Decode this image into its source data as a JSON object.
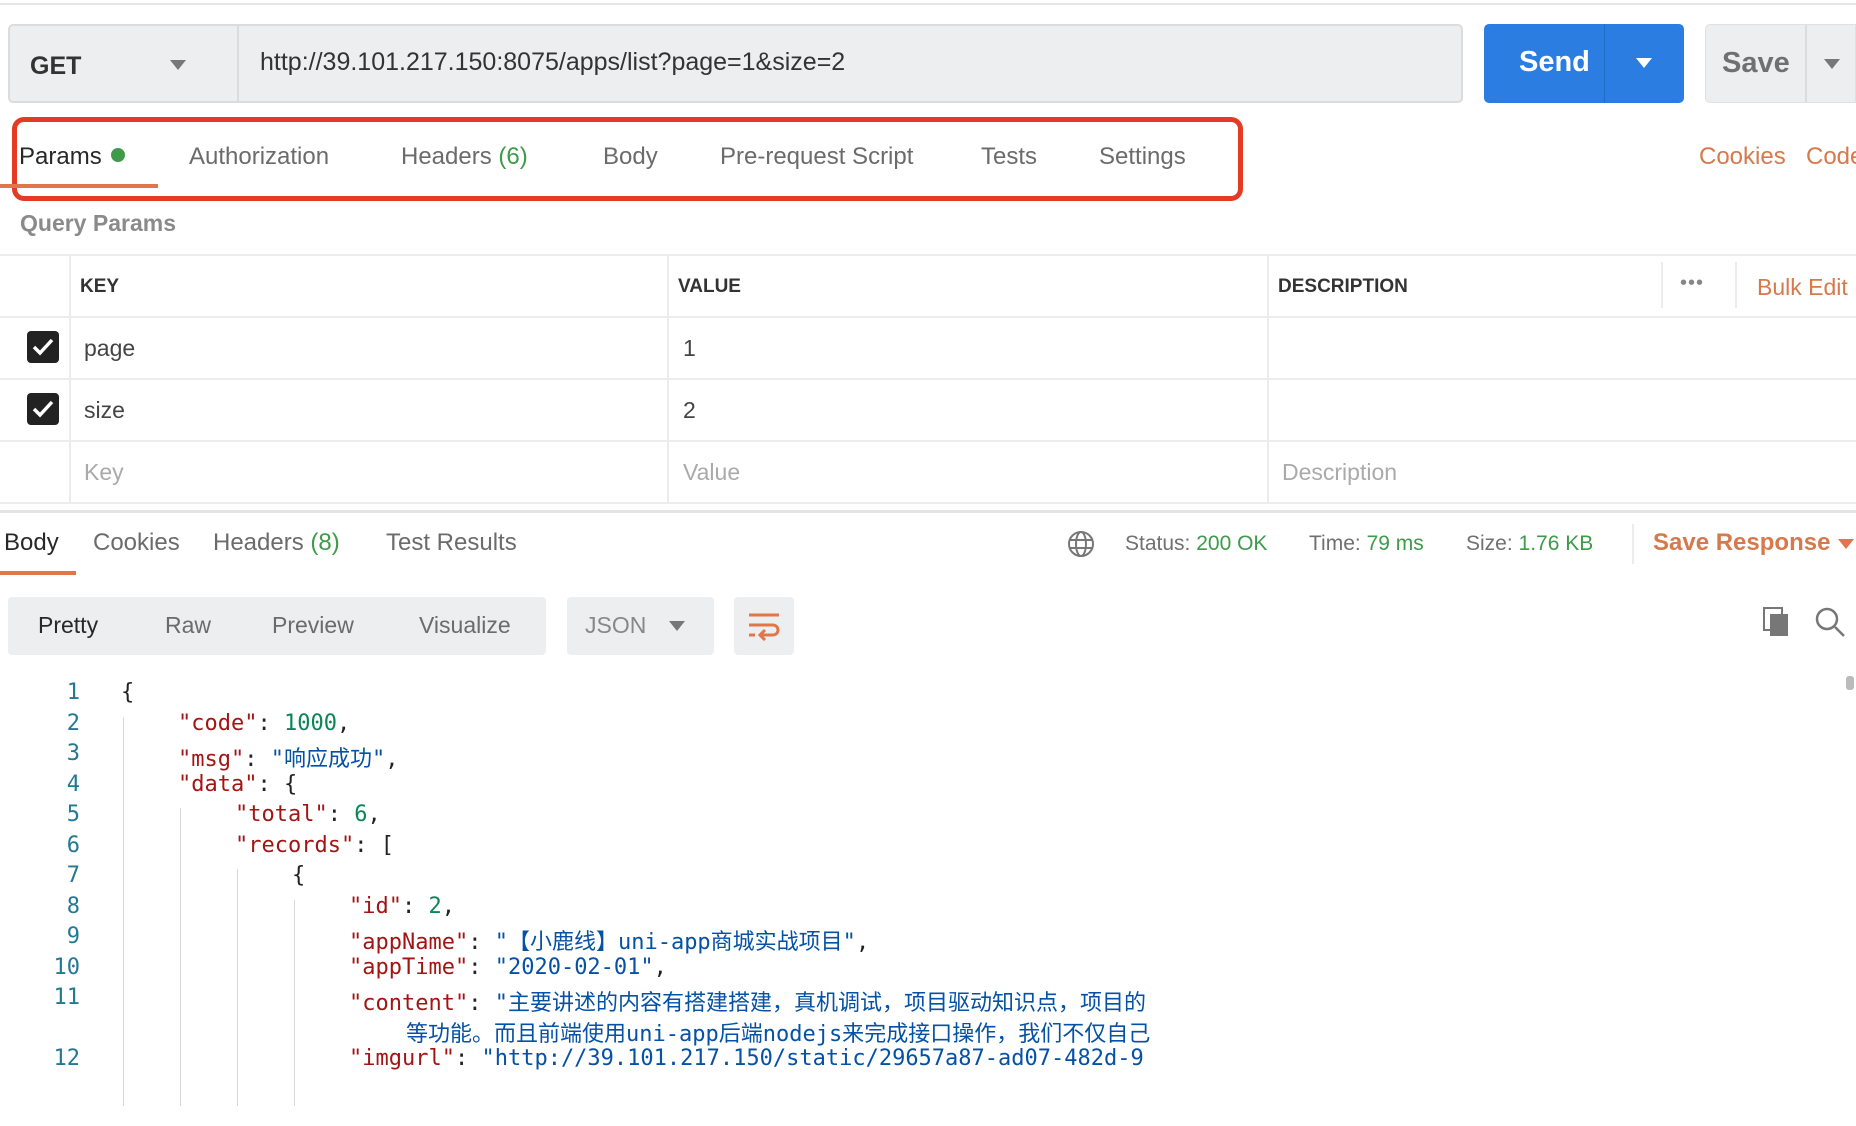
{
  "request": {
    "method": "GET",
    "url": "http://39.101.217.150:8075/apps/list?page=1&size=2",
    "send_label": "Send",
    "save_label": "Save"
  },
  "req_tabs": [
    {
      "label": "Params",
      "active": true
    },
    {
      "label": "Authorization"
    },
    {
      "label": "Headers",
      "count": "(6)"
    },
    {
      "label": "Body"
    },
    {
      "label": "Pre-request Script"
    },
    {
      "label": "Tests"
    },
    {
      "label": "Settings"
    }
  ],
  "req_links": {
    "cookies": "Cookies",
    "code": "Code"
  },
  "query_params": {
    "title": "Query Params",
    "columns": [
      "KEY",
      "VALUE",
      "DESCRIPTION"
    ],
    "more": "•••",
    "bulk_edit": "Bulk Edit",
    "rows": [
      {
        "checked": true,
        "key": "page",
        "value": "1",
        "description": ""
      },
      {
        "checked": true,
        "key": "size",
        "value": "2",
        "description": ""
      }
    ],
    "placeholder": {
      "key": "Key",
      "value": "Value",
      "description": "Description"
    }
  },
  "resp_tabs": [
    {
      "label": "Body",
      "active": true
    },
    {
      "label": "Cookies"
    },
    {
      "label": "Headers",
      "count": "(8)"
    },
    {
      "label": "Test Results"
    }
  ],
  "response_meta": {
    "status_label": "Status:",
    "status": "200 OK",
    "time_label": "Time:",
    "time": "79 ms",
    "size_label": "Size:",
    "size": "1.76 KB",
    "save_response": "Save Response"
  },
  "view_modes": [
    "Pretty",
    "Raw",
    "Preview",
    "Visualize"
  ],
  "active_view": "Pretty",
  "format": "JSON",
  "colors": {
    "accent": "#e0764a",
    "send": "#2b7de1",
    "success": "#3d9b4a",
    "highlight_box": "#e43b24"
  },
  "code_lines": [
    {
      "n": "1",
      "indent": 0,
      "parts": [
        [
          "p",
          "{"
        ]
      ]
    },
    {
      "n": "2",
      "indent": 1,
      "parts": [
        [
          "k",
          "\"code\""
        ],
        [
          "p",
          ": "
        ],
        [
          "n",
          "1000"
        ],
        [
          "p",
          ","
        ]
      ]
    },
    {
      "n": "3",
      "indent": 1,
      "parts": [
        [
          "k",
          "\"msg\""
        ],
        [
          "p",
          ": "
        ],
        [
          "s",
          "\"响应成功\""
        ],
        [
          "p",
          ","
        ]
      ]
    },
    {
      "n": "4",
      "indent": 1,
      "parts": [
        [
          "k",
          "\"data\""
        ],
        [
          "p",
          ": {"
        ]
      ]
    },
    {
      "n": "5",
      "indent": 2,
      "parts": [
        [
          "k",
          "\"total\""
        ],
        [
          "p",
          ": "
        ],
        [
          "n",
          "6"
        ],
        [
          "p",
          ","
        ]
      ]
    },
    {
      "n": "6",
      "indent": 2,
      "parts": [
        [
          "k",
          "\"records\""
        ],
        [
          "p",
          ": ["
        ]
      ]
    },
    {
      "n": "7",
      "indent": 3,
      "parts": [
        [
          "p",
          "{"
        ]
      ]
    },
    {
      "n": "8",
      "indent": 4,
      "parts": [
        [
          "k",
          "\"id\""
        ],
        [
          "p",
          ": "
        ],
        [
          "n",
          "2"
        ],
        [
          "p",
          ","
        ]
      ]
    },
    {
      "n": "9",
      "indent": 4,
      "parts": [
        [
          "k",
          "\"appName\""
        ],
        [
          "p",
          ": "
        ],
        [
          "s",
          "\"【小鹿线】uni-app商城实战项目\""
        ],
        [
          "p",
          ","
        ]
      ]
    },
    {
      "n": "10",
      "indent": 4,
      "parts": [
        [
          "k",
          "\"appTime\""
        ],
        [
          "p",
          ": "
        ],
        [
          "s",
          "\"2020-02-01\""
        ],
        [
          "p",
          ","
        ]
      ]
    },
    {
      "n": "11",
      "indent": 4,
      "parts": [
        [
          "k",
          "\"content\""
        ],
        [
          "p",
          ": "
        ],
        [
          "s",
          "\"主要讲述的内容有搭建搭建，真机调试，项目驱动知识点，项目的"
        ]
      ]
    },
    {
      "n": "",
      "indent": 5,
      "parts": [
        [
          "s",
          "等功能。而且前端使用uni-app后端nodejs来完成接口操作，我们不仅自己"
        ]
      ]
    },
    {
      "n": "12",
      "indent": 4,
      "parts": [
        [
          "k",
          "\"imgurl\""
        ],
        [
          "p",
          ": "
        ],
        [
          "s",
          "\"http://39.101.217.150/static/29657a87-ad07-482d-9"
        ]
      ]
    }
  ]
}
